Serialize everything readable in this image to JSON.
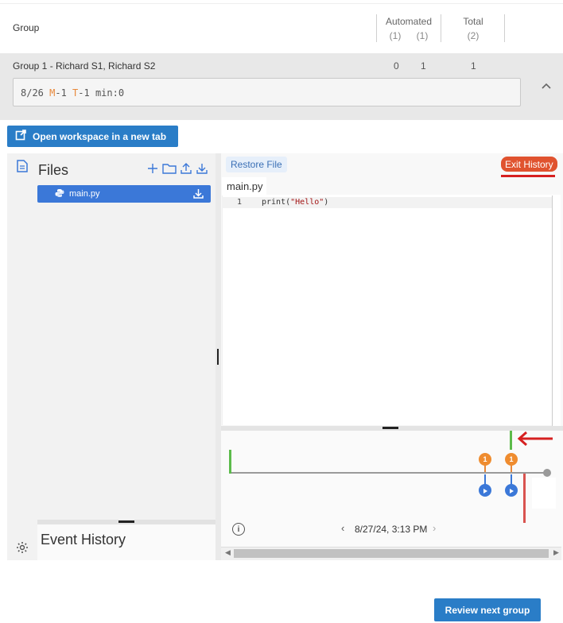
{
  "header": {
    "group_label": "Group",
    "automated_label": "Automated",
    "automated_sub_1": "(1)",
    "automated_sub_2": "(1)",
    "total_label": "Total",
    "total_sub": "(2)"
  },
  "group_row": {
    "title": "Group 1 - Richard S1, Richard S2",
    "score_1": "0",
    "score_2": "1",
    "score_total": "1",
    "grade_date": "8/26 ",
    "grade_m": "M",
    "grade_m_val": "-1 ",
    "grade_t": "T",
    "grade_t_val": "-1 min:0"
  },
  "workspace_button": "Open workspace in a new tab",
  "files": {
    "title": "Files",
    "items": [
      {
        "name": "main.py"
      }
    ]
  },
  "event_history": {
    "title": "Event History"
  },
  "editor": {
    "restore_label": "Restore File",
    "exit_history_label": "Exit History",
    "tab_name": "main.py",
    "line_number": "1",
    "code_fn": "print(",
    "code_str": "\"Hello\"",
    "code_end": ")"
  },
  "timeline": {
    "date": "8/27/24, 3:13 PM",
    "marker_count_1": "1",
    "marker_count_2": "1"
  },
  "review_button": "Review next group",
  "colors": {
    "primary_blue": "#2a7dc7",
    "exit_orange": "#e0532f",
    "marker_orange": "#ef8c2f",
    "marker_blue": "#3b78d8",
    "timeline_green": "#5cbb4b",
    "annotation_red": "#d62020"
  }
}
